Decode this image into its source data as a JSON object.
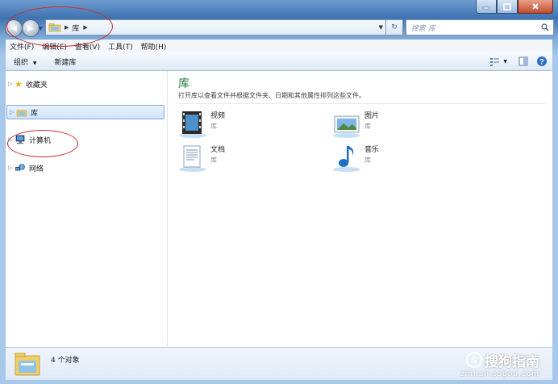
{
  "address": {
    "crumb": "库"
  },
  "search": {
    "placeholder": "搜索 库"
  },
  "menu": [
    "文件(F)",
    "编辑(E)",
    "查看(V)",
    "工具(T)",
    "帮助(H)"
  ],
  "toolbar": {
    "organize": "组织",
    "new_library": "新建库"
  },
  "nav": {
    "favorites": "收藏夹",
    "libraries": "库",
    "computer": "计算机",
    "network": "网络"
  },
  "main": {
    "title": "库",
    "description": "打开库以查看文件并根据文件夹、日期和其他属性排列这些文件。",
    "libraries": [
      {
        "name": "视频",
        "type": "库",
        "icon": "video-library-icon"
      },
      {
        "name": "图片",
        "type": "库",
        "icon": "pictures-library-icon"
      },
      {
        "name": "文档",
        "type": "库",
        "icon": "documents-library-icon"
      },
      {
        "name": "音乐",
        "type": "库",
        "icon": "music-library-icon"
      }
    ]
  },
  "status": {
    "count_text": "4 个对象"
  },
  "watermark": {
    "brand": "搜狗指南",
    "url": "zhinan.sogou.com"
  },
  "colors": {
    "title_green": "#1e7a3a",
    "annotation_red": "#cc2a2a"
  }
}
